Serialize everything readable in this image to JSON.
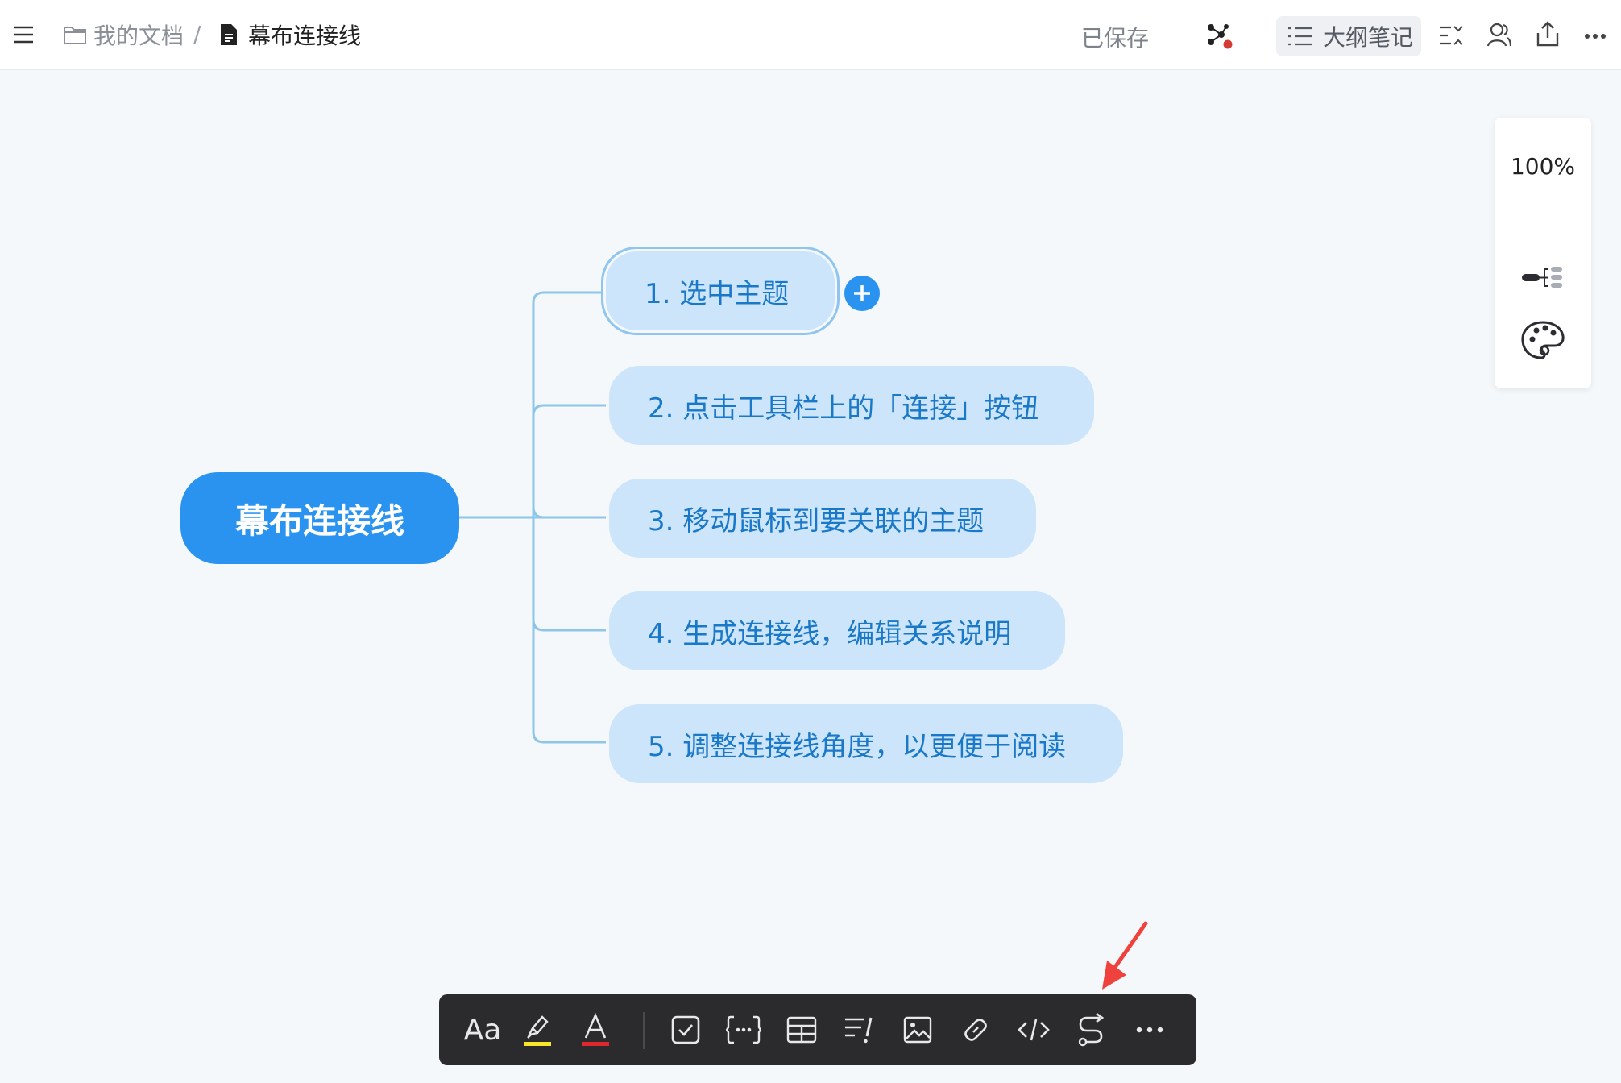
{
  "header": {
    "breadcrumb_folder": "我的文档",
    "breadcrumb_separator": "/",
    "document_title": "幕布连接线",
    "save_status": "已保存",
    "outline_button_label": "大纲笔记"
  },
  "side_panel": {
    "zoom_level": "100%"
  },
  "mindmap": {
    "root": "幕布连接线",
    "topics": [
      "1. 选中主题",
      "2. 点击工具栏上的「连接」按钮",
      "3. 移动鼠标到要关联的主题",
      "4. 生成连接线，编辑关系说明",
      "5. 调整连接线角度，以更便于阅读"
    ]
  },
  "toolbar": {
    "font_label": "Aa"
  },
  "colors": {
    "accent": "#2a93f0",
    "topic_fill": "#cce5fa",
    "topic_text": "#1a78c9",
    "toolbar_bg": "#2b2b2d",
    "highlight_yellow": "#f5e72c",
    "font_color_red": "#e0282e",
    "annotation_arrow": "#f0423d"
  },
  "icons": {
    "menu": "hamburger-icon",
    "folder": "folder-icon",
    "document": "document-icon",
    "mindmap_switch": "mindmap-view-icon",
    "outline": "list-icon",
    "collapse": "outline-collapse-icon",
    "collaborators": "user-icon",
    "share": "share-icon",
    "more": "more-icon"
  }
}
